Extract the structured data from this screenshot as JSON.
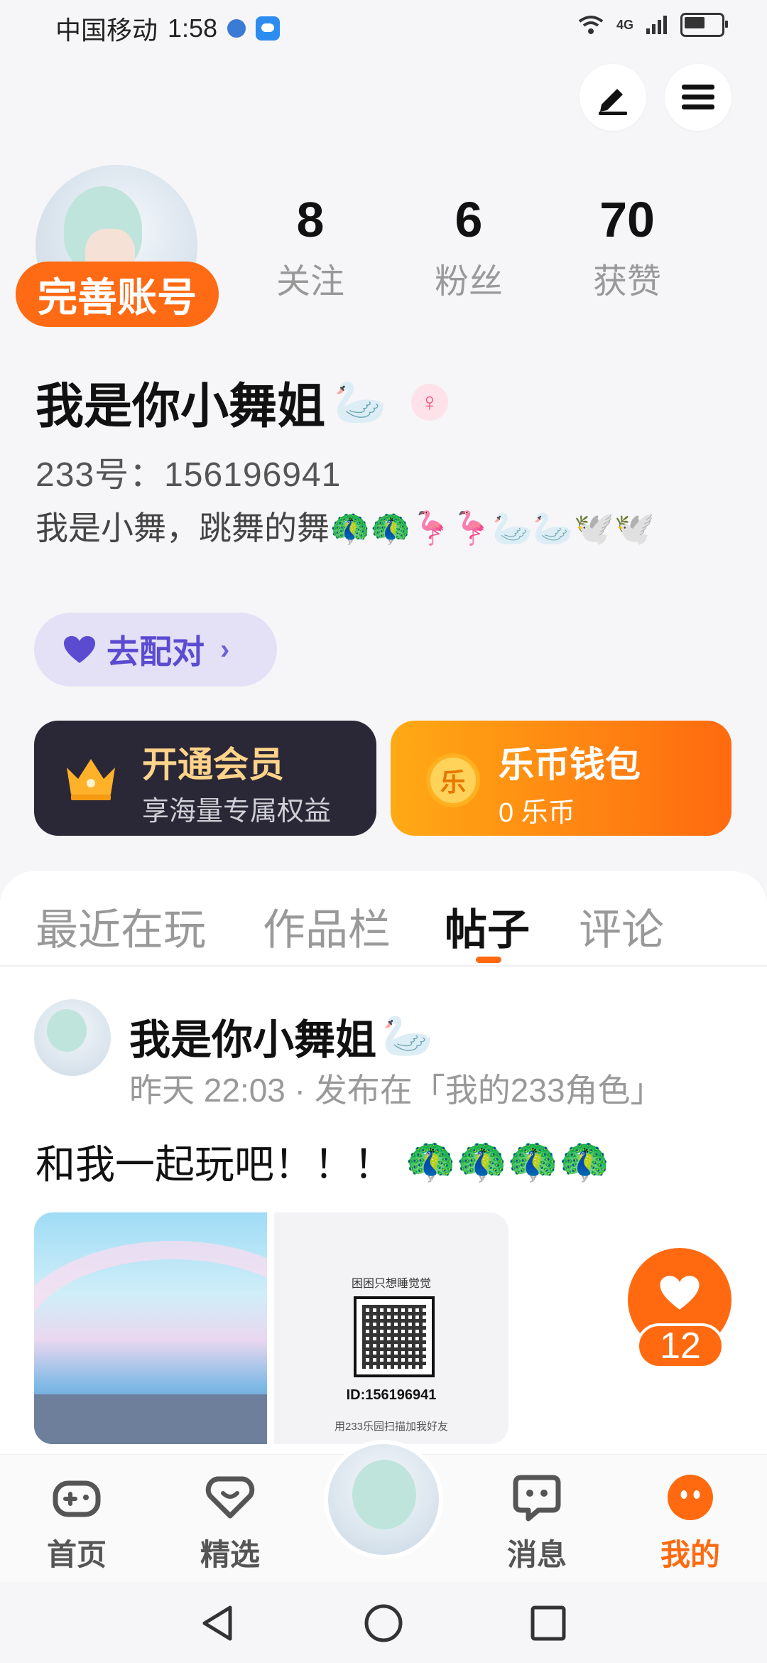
{
  "status_bar": {
    "carrier": "中国移动",
    "time": "1:58",
    "network": "4G"
  },
  "profile": {
    "complete_account_label": "完善账号",
    "stats": [
      {
        "value": "8",
        "label": "关注"
      },
      {
        "value": "6",
        "label": "粉丝"
      },
      {
        "value": "70",
        "label": "获赞"
      }
    ],
    "nickname": "我是你小舞姐",
    "nickname_emoji": "🦢",
    "gender_symbol": "♀",
    "user_id": "233号：156196941",
    "bio": "我是小舞，跳舞的舞🦚🦚🦩🦩🦢🦢🕊️🕊️",
    "match_label": "去配对",
    "match_chevron": "›"
  },
  "cards": {
    "vip": {
      "title": "开通会员",
      "subtitle": "享海量专属权益"
    },
    "wallet": {
      "title": "乐币钱包",
      "subtitle": "0 乐币",
      "coin_glyph": "乐"
    }
  },
  "tabs": [
    {
      "label": "最近在玩",
      "active": false
    },
    {
      "label": "作品栏",
      "active": false
    },
    {
      "label": "帖子",
      "active": true
    },
    {
      "label": "评论",
      "active": false
    }
  ],
  "post": {
    "author": "我是你小舞姐",
    "author_emoji": "🦢",
    "meta": "昨天 22:03 · 发布在「我的233角色」",
    "text": "和我一起玩吧！！！",
    "text_emojis": "🦚🦚🦚🦚",
    "qr_card": {
      "name": "困困只想睡觉觉",
      "id": "ID:156196941",
      "hint": "用233乐园扫描加我好友"
    },
    "like_count": "12"
  },
  "bottom_nav": [
    {
      "label": "首页",
      "icon": "gamepad-icon"
    },
    {
      "label": "精选",
      "icon": "heart-chat-icon"
    },
    {
      "label": "消息",
      "icon": "message-icon"
    },
    {
      "label": "我的",
      "icon": "face-icon",
      "active": true
    }
  ],
  "colors": {
    "accent": "#ff6a10",
    "match_purple": "#5a4bd1",
    "vip_dark": "#2a2836",
    "vip_gold": "#ffd38a"
  }
}
